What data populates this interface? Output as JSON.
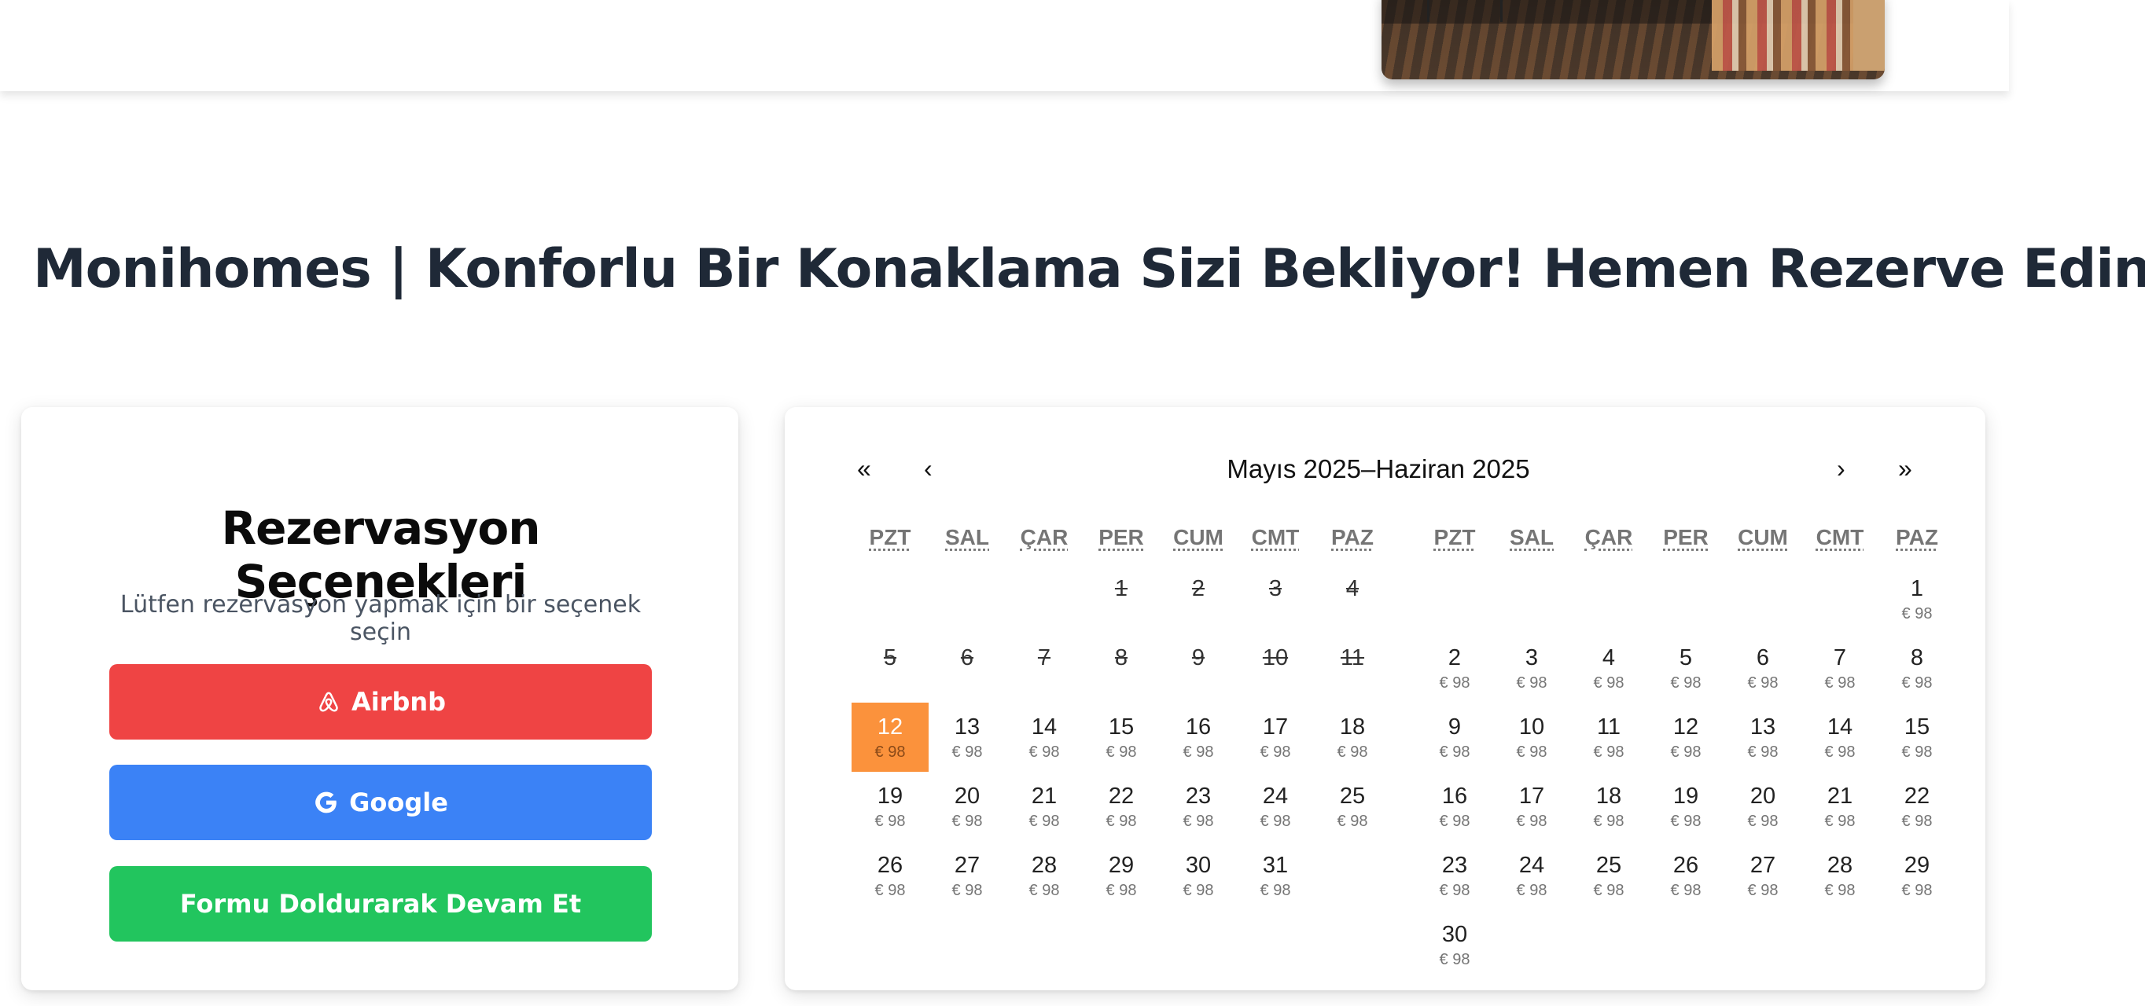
{
  "page": {
    "title": "Monihomes | Konforlu Bir Konaklama Sizi Bekliyor! Hemen Rezerve Edin!"
  },
  "reservation": {
    "title": "Rezervasyon Seçenekleri",
    "subtitle": "Lütfen rezervasyon yapmak için bir seçenek seçin",
    "buttons": {
      "airbnb": "Airbnb",
      "google": "Google",
      "form": "Formu Doldurarak Devam Et"
    },
    "colors": {
      "airbnb": "#ef4444",
      "google": "#3b82f6",
      "form": "#22c55e"
    }
  },
  "calendar": {
    "title": "Mayıs 2025–Haziran 2025",
    "nav": {
      "prev_year": "«",
      "prev_month": "‹",
      "next_month": "›",
      "next_year": "»"
    },
    "weekdays": [
      "PZT",
      "SAL",
      "ÇAR",
      "PER",
      "CUM",
      "CMT",
      "PAZ"
    ],
    "selected_color": "#fb923c",
    "months": [
      {
        "weeks": [
          [
            null,
            null,
            null,
            {
              "day": "1",
              "disabled": true
            },
            {
              "day": "2",
              "disabled": true
            },
            {
              "day": "3",
              "disabled": true
            },
            {
              "day": "4",
              "disabled": true
            }
          ],
          [
            {
              "day": "5",
              "disabled": true
            },
            {
              "day": "6",
              "disabled": true
            },
            {
              "day": "7",
              "disabled": true
            },
            {
              "day": "8",
              "disabled": true
            },
            {
              "day": "9",
              "disabled": true
            },
            {
              "day": "10",
              "disabled": true
            },
            {
              "day": "11",
              "disabled": true
            }
          ],
          [
            {
              "day": "12",
              "price": "€ 98",
              "selected": true
            },
            {
              "day": "13",
              "price": "€ 98"
            },
            {
              "day": "14",
              "price": "€ 98"
            },
            {
              "day": "15",
              "price": "€ 98"
            },
            {
              "day": "16",
              "price": "€ 98"
            },
            {
              "day": "17",
              "price": "€ 98"
            },
            {
              "day": "18",
              "price": "€ 98"
            }
          ],
          [
            {
              "day": "19",
              "price": "€ 98"
            },
            {
              "day": "20",
              "price": "€ 98"
            },
            {
              "day": "21",
              "price": "€ 98"
            },
            {
              "day": "22",
              "price": "€ 98"
            },
            {
              "day": "23",
              "price": "€ 98"
            },
            {
              "day": "24",
              "price": "€ 98"
            },
            {
              "day": "25",
              "price": "€ 98"
            }
          ],
          [
            {
              "day": "26",
              "price": "€ 98"
            },
            {
              "day": "27",
              "price": "€ 98"
            },
            {
              "day": "28",
              "price": "€ 98"
            },
            {
              "day": "29",
              "price": "€ 98"
            },
            {
              "day": "30",
              "price": "€ 98"
            },
            {
              "day": "31",
              "price": "€ 98"
            },
            null
          ]
        ]
      },
      {
        "weeks": [
          [
            null,
            null,
            null,
            null,
            null,
            null,
            {
              "day": "1",
              "price": "€ 98"
            }
          ],
          [
            {
              "day": "2",
              "price": "€ 98"
            },
            {
              "day": "3",
              "price": "€ 98"
            },
            {
              "day": "4",
              "price": "€ 98"
            },
            {
              "day": "5",
              "price": "€ 98"
            },
            {
              "day": "6",
              "price": "€ 98"
            },
            {
              "day": "7",
              "price": "€ 98"
            },
            {
              "day": "8",
              "price": "€ 98"
            }
          ],
          [
            {
              "day": "9",
              "price": "€ 98"
            },
            {
              "day": "10",
              "price": "€ 98"
            },
            {
              "day": "11",
              "price": "€ 98"
            },
            {
              "day": "12",
              "price": "€ 98"
            },
            {
              "day": "13",
              "price": "€ 98"
            },
            {
              "day": "14",
              "price": "€ 98"
            },
            {
              "day": "15",
              "price": "€ 98"
            }
          ],
          [
            {
              "day": "16",
              "price": "€ 98"
            },
            {
              "day": "17",
              "price": "€ 98"
            },
            {
              "day": "18",
              "price": "€ 98"
            },
            {
              "day": "19",
              "price": "€ 98"
            },
            {
              "day": "20",
              "price": "€ 98"
            },
            {
              "day": "21",
              "price": "€ 98"
            },
            {
              "day": "22",
              "price": "€ 98"
            }
          ],
          [
            {
              "day": "23",
              "price": "€ 98"
            },
            {
              "day": "24",
              "price": "€ 98"
            },
            {
              "day": "25",
              "price": "€ 98"
            },
            {
              "day": "26",
              "price": "€ 98"
            },
            {
              "day": "27",
              "price": "€ 98"
            },
            {
              "day": "28",
              "price": "€ 98"
            },
            {
              "day": "29",
              "price": "€ 98"
            }
          ],
          [
            {
              "day": "30",
              "price": "€ 98"
            },
            null,
            null,
            null,
            null,
            null,
            null
          ]
        ]
      }
    ]
  }
}
